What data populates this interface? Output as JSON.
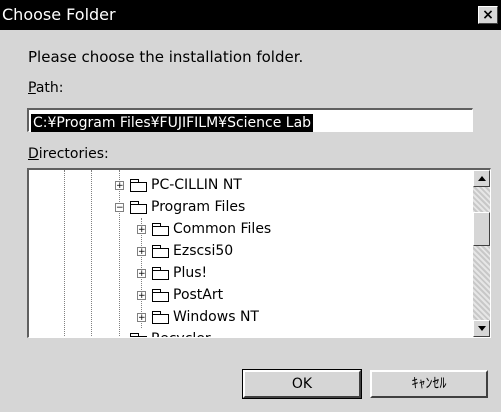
{
  "window": {
    "title": "Choose Folder",
    "close_glyph": "×"
  },
  "dialog": {
    "instruction": "Please choose the installation folder.",
    "path_label_first": "P",
    "path_label_rest": "ath:",
    "path_value": "C:¥Program Files¥FUJIFILM¥Science Lab",
    "dirs_label_first": "D",
    "dirs_label_rest": "irectories:"
  },
  "tree": {
    "items": [
      {
        "label": "PC-CILLIN NT",
        "expander": "+"
      },
      {
        "label": "Program Files",
        "expander": "−"
      },
      {
        "label": "Common Files",
        "expander": "+"
      },
      {
        "label": "Ezscsi50",
        "expander": "+"
      },
      {
        "label": "Plus!",
        "expander": "+"
      },
      {
        "label": "PostArt",
        "expander": "+"
      },
      {
        "label": "Windows NT",
        "expander": "+"
      },
      {
        "label": "Recycler",
        "expander": ""
      }
    ]
  },
  "buttons": {
    "ok": "OK",
    "cancel": "ｷｬﾝｾﾙ"
  },
  "icons": {
    "close": "close-icon",
    "folder": "folder-icon",
    "scroll_up": "arrow-up-icon",
    "scroll_down": "arrow-down-icon"
  }
}
